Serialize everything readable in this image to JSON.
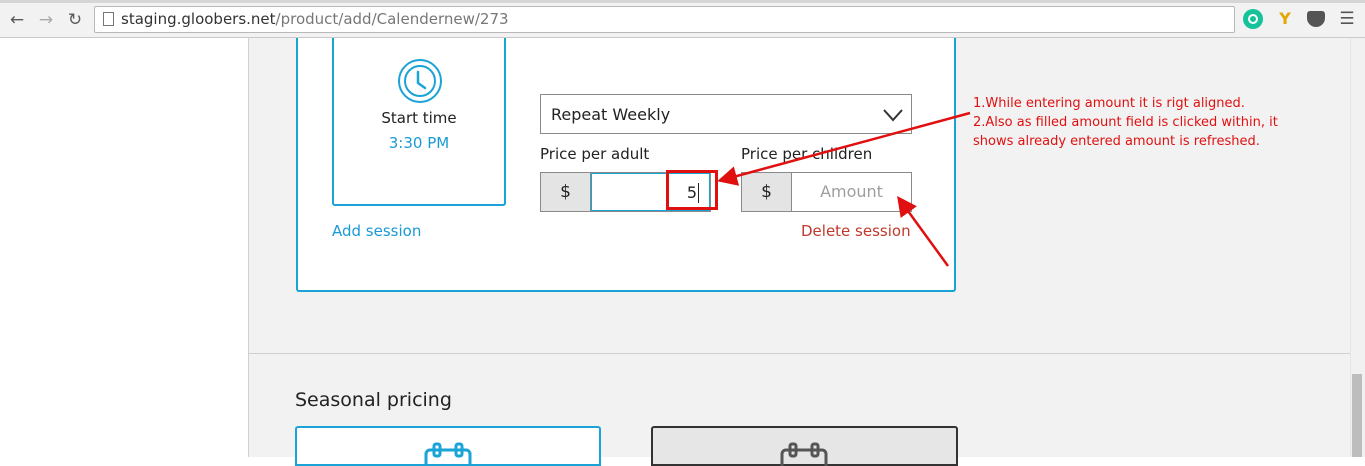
{
  "browser": {
    "url_host": "staging.gloobers.net",
    "url_path": "/product/add/Calendernew/273"
  },
  "session": {
    "start_time_label": "Start time",
    "start_time_value": "3:30 PM",
    "add_session_label": "Add session",
    "repeat_value": "Repeat Weekly",
    "price_adult_label": "Price per adult",
    "price_children_label": "Price per children",
    "currency_symbol": "$",
    "adult_amount_value": "5",
    "children_amount_placeholder": "Amount",
    "delete_session_label": "Delete session"
  },
  "annotation": {
    "line1": "1.While entering amount it is rigt aligned.",
    "line2": "2.Also as filled amount field is clicked within, it",
    "line3": "shows already entered amount is refreshed.",
    "color": "#e01010"
  },
  "seasonal": {
    "title": "Seasonal pricing"
  },
  "colors": {
    "accent": "#1aa3d6",
    "danger": "#c0392b"
  }
}
